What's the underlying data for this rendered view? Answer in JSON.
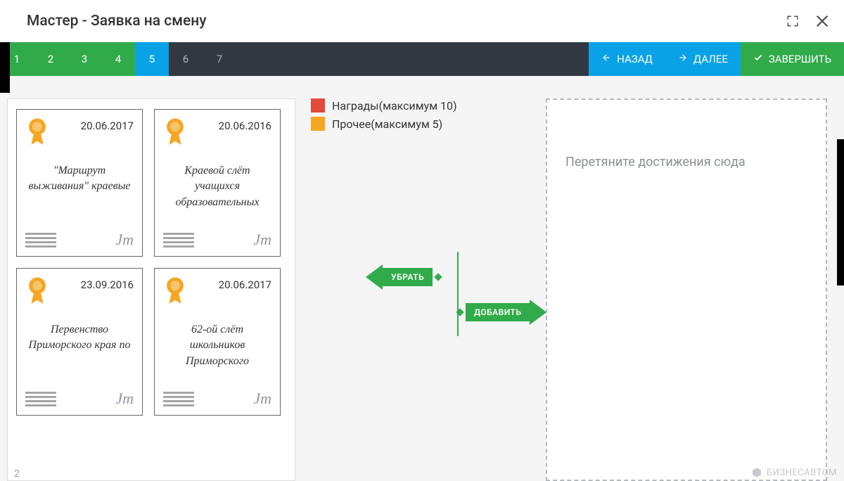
{
  "header": {
    "title": "Мастер - Заявка на смену"
  },
  "steps": {
    "items": [
      "1",
      "2",
      "3",
      "4",
      "5",
      "6",
      "7"
    ],
    "active_index": 4
  },
  "nav": {
    "back": "НАЗАД",
    "next": "ДАЛЕЕ",
    "finish": "ЗАВЕРШИТЬ"
  },
  "legend": {
    "awards": "Награды(максимум 10)",
    "other": "Прочее(максимум 5)"
  },
  "arrows": {
    "remove": "УБРАТЬ",
    "add": "ДОБАВИТЬ"
  },
  "dropzone": {
    "placeholder": "Перетяните достижения сюда"
  },
  "certs": [
    {
      "date": "20.06.2017",
      "title": "\"Маршрут выживания\" краевые"
    },
    {
      "date": "20.06.2016",
      "title": "Краевой слёт учащихся образовательных"
    },
    {
      "date": "23.09.2016",
      "title": "Первенство Приморского края по"
    },
    {
      "date": "20.06.2017",
      "title": "62-ой слёт школьников Приморского"
    }
  ],
  "footer": {
    "page": "2",
    "brand": "БизнесАвтом"
  }
}
